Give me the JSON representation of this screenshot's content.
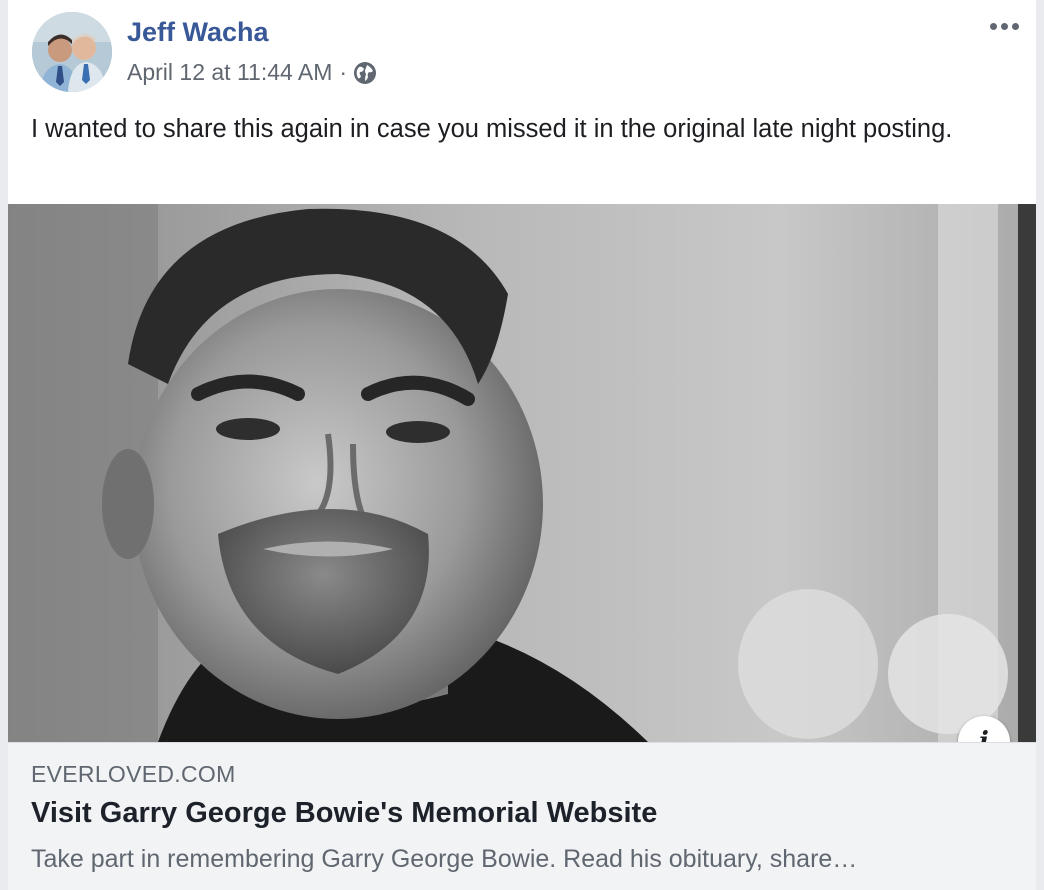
{
  "post": {
    "author": "Jeff Wacha",
    "timestamp": "April 12 at 11:44 AM",
    "separator": "·",
    "audience_icon": "globe-icon",
    "menu_icon": "more-options-icon",
    "text": "I wanted to share this again in case you missed it in the original late night posting."
  },
  "link_preview": {
    "domain": "EVERLOVED.COM",
    "title": "Visit Garry George Bowie's Memorial Website",
    "description": "Take part in remembering Garry George Bowie. Read his obituary, share…",
    "info_label": "i"
  },
  "colors": {
    "author_link": "#385898",
    "secondary_text": "#606770",
    "footer_bg": "#f2f3f5"
  }
}
